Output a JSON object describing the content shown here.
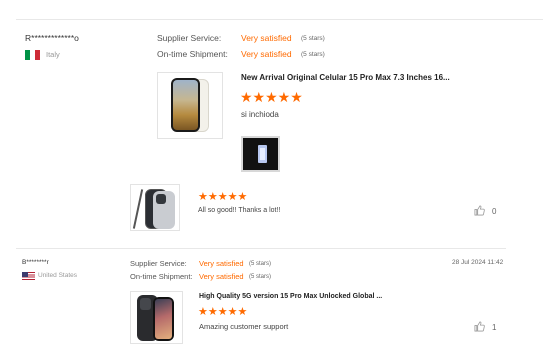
{
  "review1": {
    "user": "R*************o",
    "country": "Italy",
    "supplier_label": "Supplier Service:",
    "supplier_value": "Very satisfied",
    "supplier_stars": "(5 stars)",
    "shipment_label": "On-time Shipment:",
    "shipment_value": "Very satisfied",
    "shipment_stars": "(5 stars)",
    "product_title": "New Arrival Original Celular 15 Pro Max 7.3 Inches 16...",
    "rating": 5,
    "rating_stars": "★★★★★",
    "comment": "si inchioda",
    "followup_stars": "★★★★★",
    "followup_comment": "All so good!! Thanks a lot!!",
    "helpful_count": "0"
  },
  "review2": {
    "user": "B********r",
    "country": "United States",
    "date": "28 Jul 2024 11:42",
    "supplier_label": "Supplier Service:",
    "supplier_value": "Very satisfied",
    "supplier_stars": "(5 stars)",
    "shipment_label": "On-time Shipment:",
    "shipment_value": "Very satisfied",
    "shipment_stars": "(5 stars)",
    "product_title": "High Quality 5G version 15 Pro Max Unlocked Global ...",
    "rating": 5,
    "rating_stars": "★★★★★",
    "comment": "Amazing customer support",
    "helpful_count": "1"
  },
  "colors": {
    "accent": "#ff6a00",
    "divider": "#e8e8e8",
    "text": "#333333",
    "muted": "#999999"
  },
  "icons": [
    "flag-italy-icon",
    "flag-us-icon",
    "thumbs-up-icon"
  ]
}
